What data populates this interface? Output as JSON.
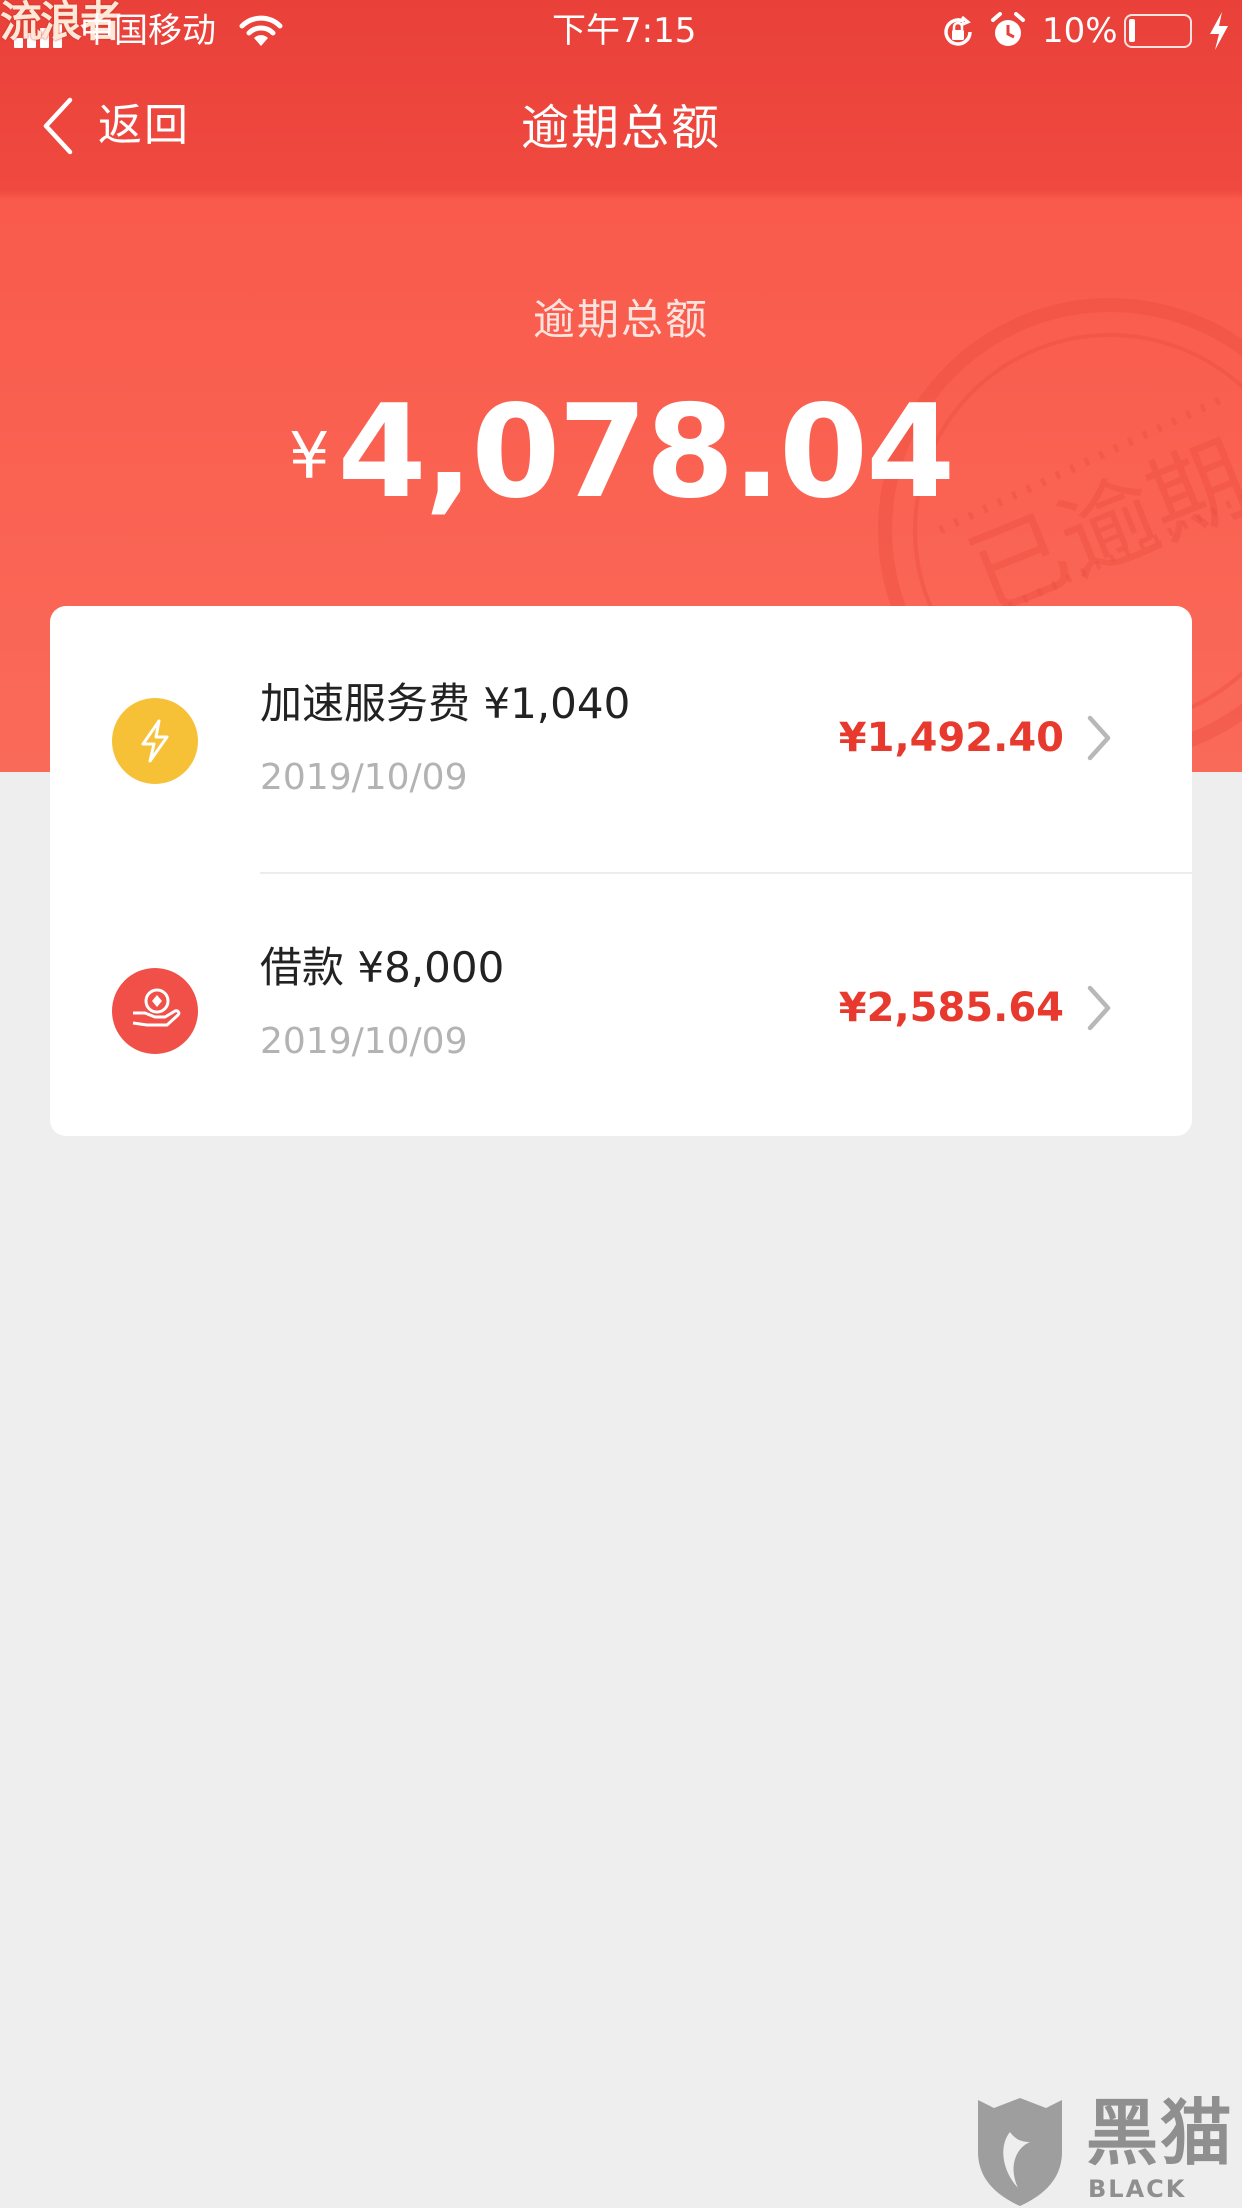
{
  "status_bar": {
    "watermark": "流浪者",
    "carrier": "中国移动",
    "time": "下午7:15",
    "battery": "10%"
  },
  "nav": {
    "back_label": "返回",
    "title": "逾期总额"
  },
  "summary": {
    "label": "逾期总额",
    "currency": "¥",
    "amount": "4,078.04",
    "stamp_text": "已逾期"
  },
  "items": [
    {
      "icon": "lightning-icon",
      "title": "加速服务费 ¥1,040",
      "date": "2019/10/09",
      "amount": "¥1,492.40"
    },
    {
      "icon": "hand-coin-icon",
      "title": "借款 ¥8,000",
      "date": "2019/10/09",
      "amount": "¥2,585.64"
    }
  ],
  "watermark": {
    "brand_cn": "黑猫",
    "brand_en": "BLACK CAT"
  },
  "colors": {
    "brand_red": "#f0493f",
    "amount_red": "#e8392e",
    "lightning_bg": "#f7c137",
    "loan_bg": "#f05048",
    "page_bg": "#eeeeee"
  }
}
